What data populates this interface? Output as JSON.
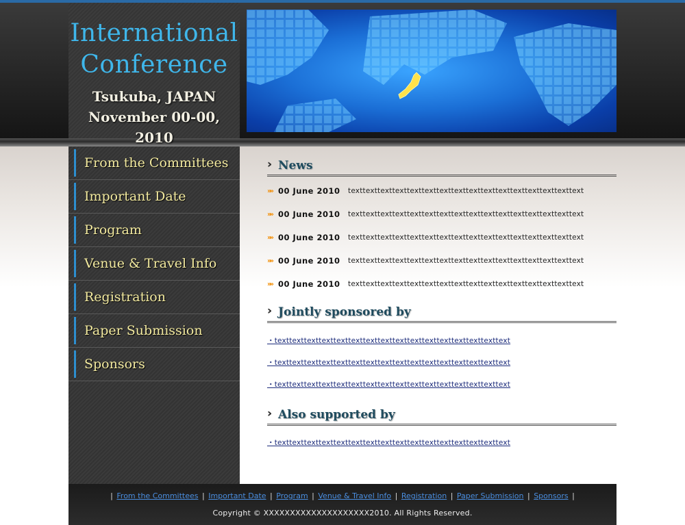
{
  "header": {
    "title_line1": "International",
    "title_line2": "Conference",
    "place": "Tsukuba, JAPAN",
    "date": "November 00-00, 2010"
  },
  "sidebar": {
    "items": [
      {
        "label": "From the Committees"
      },
      {
        "label": "Important Date"
      },
      {
        "label": "Program"
      },
      {
        "label": "Venue & Travel Info"
      },
      {
        "label": "Registration"
      },
      {
        "label": "Paper Submission"
      },
      {
        "label": "Sponsors"
      }
    ]
  },
  "news": {
    "heading": "News",
    "items": [
      {
        "date": "00 June 2010",
        "text": "texttexttexttexttexttexttexttexttexttexttexttexttexttexttexttext"
      },
      {
        "date": "00 June 2010",
        "text": "texttexttexttexttexttexttexttexttexttexttexttexttexttexttexttext"
      },
      {
        "date": "00 June 2010",
        "text": "texttexttexttexttexttexttexttexttexttexttexttexttexttexttexttext"
      },
      {
        "date": "00 June 2010",
        "text": "texttexttexttexttexttexttexttexttexttexttexttexttexttexttexttext"
      },
      {
        "date": "00 June 2010",
        "text": "texttexttexttexttexttexttexttexttexttexttexttexttexttexttexttext"
      }
    ]
  },
  "jointly": {
    "heading": "Jointly sponsored by",
    "links": [
      "・texttexttexttexttexttexttexttexttexttexttexttexttexttexttexttext",
      "・texttexttexttexttexttexttexttexttexttexttexttexttexttexttexttext",
      "・texttexttexttexttexttexttexttexttexttexttexttexttexttexttexttext"
    ]
  },
  "also": {
    "heading": "Also supported by",
    "links": [
      "・texttexttexttexttexttexttexttexttexttexttexttexttexttexttexttext"
    ]
  },
  "footer": {
    "links": [
      "From the Committees",
      "Important Date",
      "Program",
      "Venue & Travel Info",
      "Registration",
      "Paper Submission",
      "Sponsors"
    ],
    "separator": "|",
    "copyright": "Copyright © XXXXXXXXXXXXXXXXXXXX2010. All Rights Reserved."
  },
  "colors": {
    "title_blue": "#3fb6ea",
    "nav_text": "#f4eba0",
    "nav_bar": "#2d8fd0",
    "news_arrow": "#f28c00",
    "heading_text": "#1f4b5e",
    "footer_link": "#4a8ee0"
  },
  "icons": {
    "nav_marker": "vertical-bar",
    "section_marker": "double-chevron-right",
    "news_marker": "double-chevron-right-orange",
    "banner": "world-map-japan-highlight"
  }
}
